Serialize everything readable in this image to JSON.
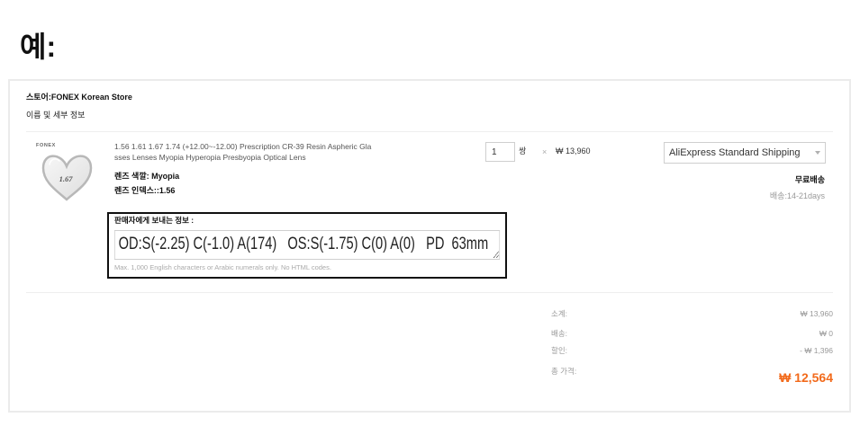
{
  "example_label": "예:",
  "colors": {
    "accent": "#f26a1b",
    "panel_border": "#ebebeb",
    "highlight_border": "#111111",
    "muted_text": "#999999"
  },
  "store": {
    "label": "스토어:",
    "name": "FONEX Korean Store"
  },
  "section_title": "이름 및 세부 정보",
  "product": {
    "image": {
      "brand": "FONEX",
      "index": "1.67"
    },
    "title_lines": [
      "1.56 1.61 1.67 1.74 (+12.00~-12.00) Prescription CR-39 Resin Aspheric Gla",
      "sses Lenses Myopia Hyperopia Presbyopia Optical Lens"
    ],
    "properties": [
      "렌즈 색깔: Myopia",
      "렌즈 인덱스::1.56"
    ],
    "quantity": "1",
    "quantity_unit": "쌍",
    "multiply_sign": "×",
    "unit_price": "₩ 13,960",
    "shipping": {
      "method": "AliExpress Standard Shipping",
      "dropdown_icon": "caret-down-icon",
      "cost": "무료배송",
      "delivery_time": "배송:14-21days"
    }
  },
  "seller_message": {
    "label": "판매자에게 보내는 정보 :",
    "value": "OD:S(-2.25) C(-1.0) A(174)   OS:S(-1.75) C(0) A(0)   PD  63mm",
    "hint": "Max. 1,000 English characters or Arabic numerals only. No HTML codes."
  },
  "summary": {
    "subtotal": {
      "label": "소계:",
      "value": "₩ 13,960"
    },
    "shipping": {
      "label": "배송:",
      "value": "₩ 0"
    },
    "discount": {
      "label": "할인:",
      "value": "- ₩ 1,396"
    },
    "total": {
      "label": "총 가격:",
      "value": "₩ 12,564"
    }
  }
}
